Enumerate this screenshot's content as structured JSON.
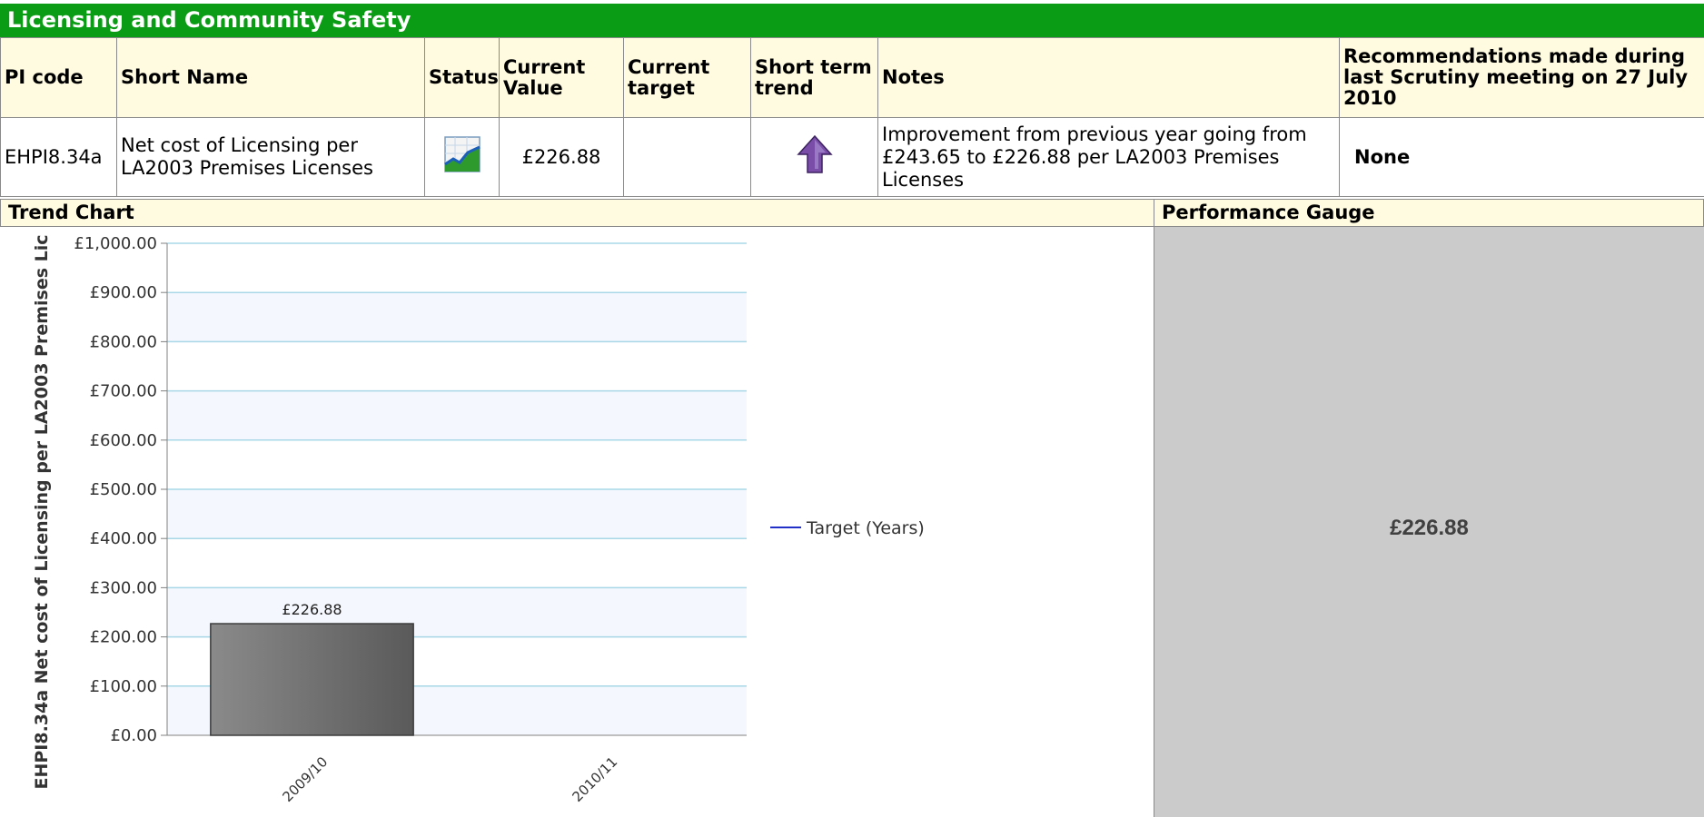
{
  "section_title": "Licensing and Community Safety",
  "table": {
    "headers": [
      "PI code",
      "Short Name",
      "Status",
      "Current Value",
      "Current target",
      "Short term trend",
      "Notes",
      "Recommendations made during last Scrutiny meeting on 27 July 2010"
    ],
    "row": {
      "pi_code": "EHPI8.34a",
      "short_name": "Net cost of Licensing per LA2003 Premises Licenses",
      "status_icon": "data-only-chart-icon",
      "current_value": "£226.88",
      "current_target": "",
      "trend_icon": "up-arrow-icon",
      "notes": "Improvement from previous year going from £243.65 to £226.88 per LA2003 Premises Licenses",
      "recommendations": "None"
    }
  },
  "trend_chart_label": "Trend Chart",
  "gauge_label": "Performance Gauge",
  "gauge_value": "£226.88",
  "colors": {
    "title_bar": "#0a9c14",
    "header_bg": "#fffbe0",
    "gauge_bg": "#cbcbcb",
    "bar": "#6e6e6e",
    "target_line": "#2230c8"
  },
  "chart_data": {
    "type": "bar",
    "categories": [
      "2009/10",
      "2010/11"
    ],
    "series": [
      {
        "name": "",
        "values": [
          226.88,
          null
        ]
      },
      {
        "name": "Target (Years)",
        "values": [
          null,
          null
        ]
      }
    ],
    "data_labels": [
      "£226.88",
      ""
    ],
    "ylabel": "EHPI8.34a Net cost of Licensing per LA2003 Premises Lic",
    "ylim": [
      0,
      1000
    ],
    "yticks": [
      0,
      100,
      200,
      300,
      400,
      500,
      600,
      700,
      800,
      900,
      1000
    ],
    "ytick_labels": [
      "£0.00",
      "£100.00",
      "£200.00",
      "£300.00",
      "£400.00",
      "£500.00",
      "£600.00",
      "£700.00",
      "£800.00",
      "£900.00",
      "£1,000.00"
    ],
    "legend": [
      "Target (Years)"
    ],
    "legend_position": "right",
    "grid": true
  }
}
